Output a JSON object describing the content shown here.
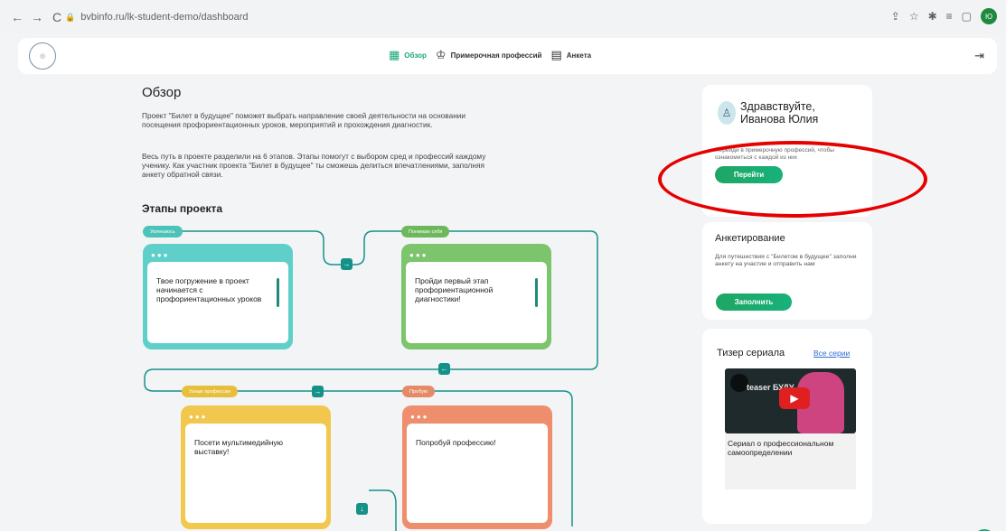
{
  "browser": {
    "back": "←",
    "forward": "→",
    "reload": "C",
    "url": "bvbinfo.ru/lk-student-demo/dashboard",
    "profile_initials": "Ю"
  },
  "nav": {
    "items": [
      {
        "label": "Обзор",
        "icon": "▦"
      },
      {
        "label": "Примерочная профессий",
        "icon": "♔"
      },
      {
        "label": "Анкета",
        "icon": "▤"
      }
    ],
    "logout_icon": "⇥"
  },
  "overview": {
    "title": "Обзор",
    "p1": "Проект \"Билет в будущее\" поможет выбрать направление своей деятельности на основании посещения профориентационных уроков, мероприятий и прохождения диагностик.",
    "p2": "Весь путь в проекте разделили на 6 этапов. Этапы помогут с выбором сред и профессий каждому ученику. Как участник проекта \"Билет в будущее\" ты сможешь делиться впечатлениями, заполняя анкету обратной связи."
  },
  "stages": {
    "title": "Этапы проекта",
    "items": [
      {
        "tag": "Увлекаюсь",
        "text": "Твое погружение в проект начинается с профориентационных уроков",
        "color": "#5fd0c9"
      },
      {
        "tag": "Понимаю себя",
        "text": "Пройди первый этап профориентационной диагностики!",
        "color": "#7cc56c"
      },
      {
        "tag": "Узнаю профессии",
        "text": "Посети мультимедийную выставку!",
        "color": "#f1c84d"
      },
      {
        "tag": "Пробую",
        "text": "Попробуй профессию!",
        "color": "#ee8e6c"
      }
    ],
    "arrows": [
      "→",
      "←",
      "→",
      "↓"
    ]
  },
  "hello": {
    "line1": "Здравствуйте,",
    "line2": "Иванова Юлия",
    "hint": "Перейди в примерочную профессий, чтобы ознакомиться с каждой из них",
    "button": "Перейти"
  },
  "survey": {
    "title": "Анкетирование",
    "text": "Для путешествия с \"Билетом в будущее\" заполни анкету на участие и отправить нам",
    "button": "Заполнить"
  },
  "teaser": {
    "title": "Тизер сериала",
    "all_link": "Все серии",
    "video_text": "teaser БУДУ",
    "caption": "Сериал о профессиональном самоопределении"
  },
  "colors": {
    "accent": "#19a974",
    "annotation": "#e60000"
  }
}
